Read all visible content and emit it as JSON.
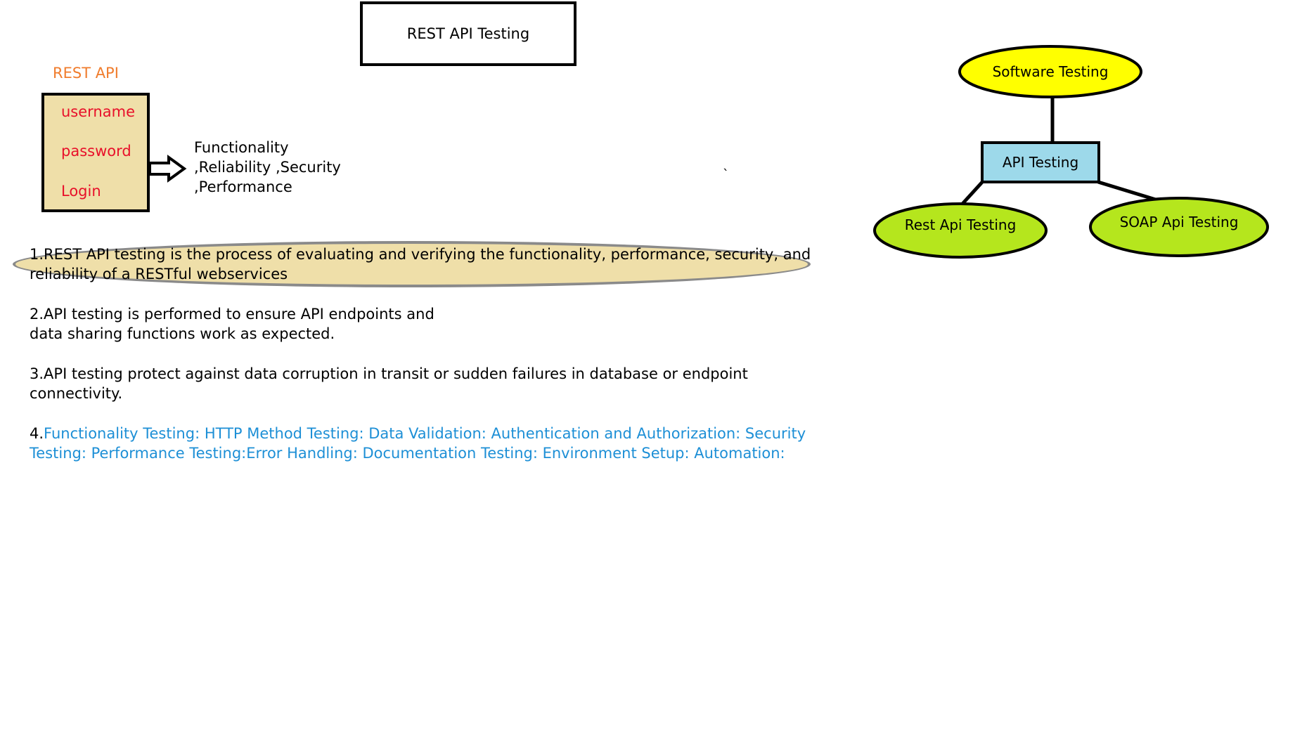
{
  "title": "REST API Testing",
  "login_mock": {
    "label": "REST API",
    "fields": [
      "username",
      "password",
      "Login"
    ]
  },
  "aspects_text": "Functionality\n,Reliability ,Security\n,Performance",
  "stray_mark": "`",
  "points": {
    "p1": "1.REST API testing is the process of evaluating and verifying the functionality, performance, security, and reliability of a RESTful  webservices",
    "p2": "2.API testing is performed to ensure API endpoints and\ndata sharing functions work as expected.",
    "p3": "3.API testing protect against data corruption in transit or sudden failures in database or endpoint connectivity.",
    "p4_num": "4.",
    "p4_text": "Functionality Testing: HTTP Method Testing: Data Validation: Authentication and Authorization: Security Testing:  Performance Testing:Error Handling: Documentation Testing: Environment Setup: Automation:"
  },
  "tree": {
    "root": "Software Testing",
    "middle": "API Testing",
    "left_leaf": "Rest Api Testing",
    "right_leaf": "SOAP Api Testing"
  },
  "colors": {
    "login_bg": "#efdfa9",
    "rest_label": "#f07c2c",
    "login_text": "#e8102a",
    "point4_text": "#1d8fd6",
    "root_fill": "#ffff00",
    "middle_fill": "#9dd9ea",
    "leaf_fill": "#b5e61d"
  }
}
